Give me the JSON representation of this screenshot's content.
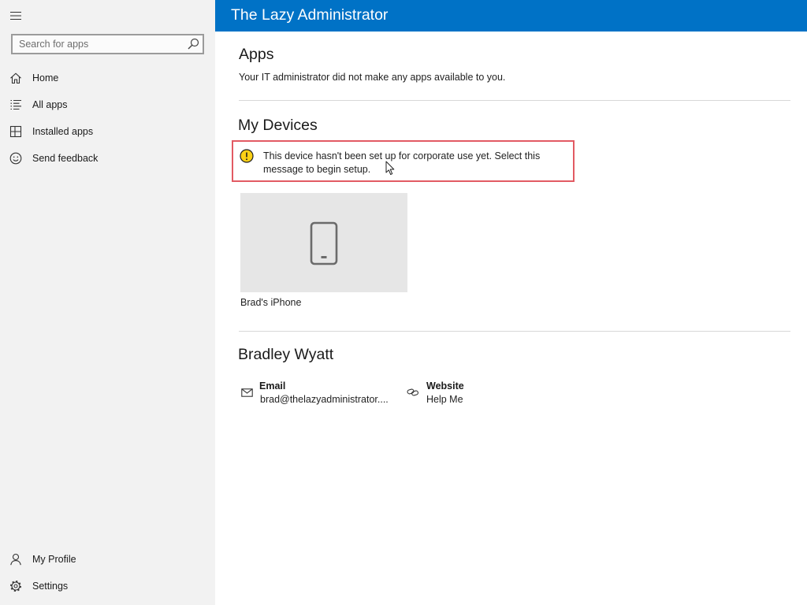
{
  "sidebar": {
    "menu_icon": "hamburger-menu-icon",
    "search": {
      "placeholder": "Search for apps",
      "icon": "search-icon"
    },
    "nav": [
      {
        "label": "Home",
        "icon": "home-icon"
      },
      {
        "label": "All apps",
        "icon": "list-icon"
      },
      {
        "label": "Installed apps",
        "icon": "installed-apps-icon"
      },
      {
        "label": "Send feedback",
        "icon": "smiley-icon"
      }
    ],
    "footer": [
      {
        "label": "My Profile",
        "icon": "person-icon"
      },
      {
        "label": "Settings",
        "icon": "gear-icon"
      }
    ]
  },
  "header": {
    "title": "The Lazy Administrator"
  },
  "apps": {
    "heading": "Apps",
    "message": "Your IT administrator did not make any apps available to you."
  },
  "devices": {
    "heading": "My Devices",
    "notice": {
      "icon": "warning-icon",
      "text": "This device hasn't been set up for corporate use yet. Select this message to begin setup."
    },
    "items": [
      {
        "name": "Brad's iPhone",
        "icon": "phone-icon"
      }
    ]
  },
  "profile": {
    "name": "Bradley Wyatt",
    "contacts": [
      {
        "label": "Email",
        "value": "brad@thelazyadministrator....",
        "icon": "email-icon"
      },
      {
        "label": "Website",
        "value": "Help Me",
        "icon": "link-icon"
      }
    ]
  },
  "pointer": {
    "icon": "mouse-pointer-icon"
  },
  "colors": {
    "accent": "#0072c6",
    "notice_border": "#e25a63",
    "warning_fill": "#fcd116"
  }
}
